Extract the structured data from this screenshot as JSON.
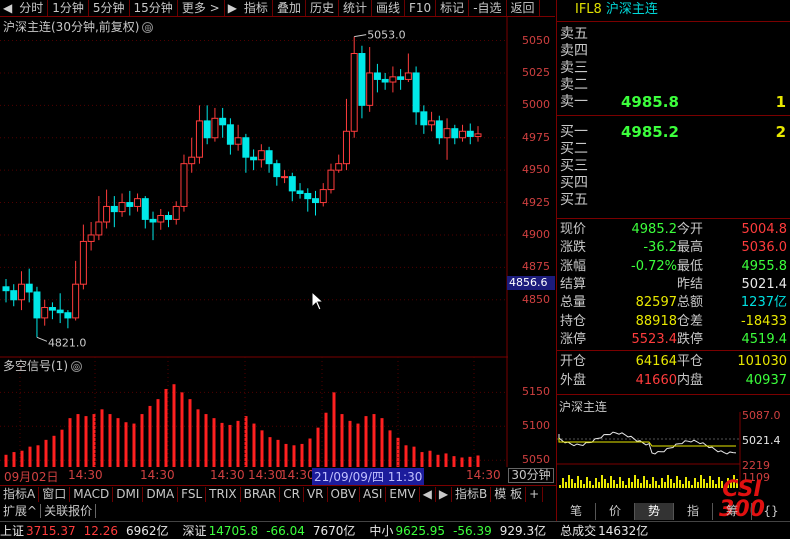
{
  "toolbar": {
    "items": [
      "分时",
      "1分钟",
      "5分钟",
      "15分钟",
      "更多 >",
      "指标",
      "叠加",
      "历史",
      "统计",
      "画线",
      "F10",
      "标记",
      "-自选",
      "返回"
    ],
    "arrow_left": "◀",
    "arrow_right": "▶"
  },
  "chart": {
    "title": "沪深主连(30分钟,前复权)",
    "title_icon": "◎",
    "price_labels": [
      "5050",
      "5025",
      "5000",
      "4975",
      "4950",
      "4925",
      "4900",
      "4875",
      "4850"
    ],
    "current_price_tag": "4856.6",
    "high_mark": "5053.0",
    "low_mark": "4821.0"
  },
  "chart_data": [
    {
      "type": "candlestick",
      "title": "沪深主连(30分钟,前复权)",
      "ylim": [
        4812,
        5062
      ],
      "candles": [
        [
          4860,
          4857,
          4866,
          4848
        ],
        [
          4857,
          4850,
          4862,
          4845
        ],
        [
          4850,
          4862,
          4872,
          4842
        ],
        [
          4862,
          4856,
          4874,
          4848
        ],
        [
          4856,
          4836,
          4860,
          4821
        ],
        [
          4836,
          4844,
          4850,
          4830
        ],
        [
          4844,
          4842,
          4848,
          4835
        ],
        [
          4842,
          4840,
          4855,
          4832
        ],
        [
          4840,
          4836,
          4842,
          4828
        ],
        [
          4836,
          4862,
          4880,
          4834
        ],
        [
          4862,
          4895,
          4908,
          4858
        ],
        [
          4895,
          4900,
          4910,
          4888
        ],
        [
          4900,
          4910,
          4930,
          4896
        ],
        [
          4910,
          4922,
          4935,
          4905
        ],
        [
          4922,
          4918,
          4930,
          4906
        ],
        [
          4918,
          4925,
          4932,
          4914
        ],
        [
          4925,
          4922,
          4934,
          4915
        ],
        [
          4922,
          4928,
          4932,
          4918
        ],
        [
          4928,
          4912,
          4930,
          4905
        ],
        [
          4912,
          4910,
          4918,
          4896
        ],
        [
          4910,
          4915,
          4920,
          4904
        ],
        [
          4915,
          4912,
          4918,
          4906
        ],
        [
          4912,
          4922,
          4926,
          4908
        ],
        [
          4922,
          4955,
          4962,
          4918
        ],
        [
          4955,
          4960,
          4975,
          4948
        ],
        [
          4960,
          4988,
          5000,
          4955
        ],
        [
          4988,
          4975,
          5000,
          4970
        ],
        [
          4975,
          4990,
          4998,
          4972
        ],
        [
          4990,
          4985,
          4998,
          4975
        ],
        [
          4985,
          4970,
          4990,
          4962
        ],
        [
          4970,
          4975,
          4985,
          4965
        ],
        [
          4975,
          4960,
          4978,
          4948
        ],
        [
          4960,
          4958,
          4966,
          4950
        ],
        [
          4958,
          4965,
          4970,
          4952
        ],
        [
          4965,
          4955,
          4968,
          4948
        ],
        [
          4955,
          4945,
          4958,
          4938
        ],
        [
          4945,
          4945,
          4950,
          4940
        ],
        [
          4945,
          4934,
          4948,
          4926
        ],
        [
          4934,
          4932,
          4940,
          4928
        ],
        [
          4932,
          4928,
          4936,
          4918
        ],
        [
          4928,
          4925,
          4934,
          4915
        ],
        [
          4925,
          4935,
          4940,
          4922
        ],
        [
          4935,
          4950,
          4955,
          4932
        ],
        [
          4950,
          4955,
          4962,
          4948
        ],
        [
          4955,
          4980,
          5005,
          4950
        ],
        [
          4980,
          5040,
          5053,
          4975
        ],
        [
          5040,
          5000,
          5046,
          4990
        ],
        [
          5000,
          5025,
          5045,
          4995
        ],
        [
          5025,
          5020,
          5032,
          5010
        ],
        [
          5020,
          5018,
          5025,
          5012
        ],
        [
          5018,
          5022,
          5030,
          5010
        ],
        [
          5022,
          5020,
          5028,
          5012
        ],
        [
          5020,
          5025,
          5040,
          5018
        ],
        [
          5025,
          4995,
          5030,
          4985
        ],
        [
          4995,
          4985,
          5000,
          4978
        ],
        [
          4985,
          4988,
          4995,
          4980
        ],
        [
          4988,
          4975,
          4992,
          4970
        ],
        [
          4975,
          4982,
          4990,
          4958
        ],
        [
          4982,
          4975,
          4985,
          4970
        ],
        [
          4975,
          4980,
          4985,
          4972
        ],
        [
          4980,
          4976,
          4986,
          4970
        ],
        [
          4976,
          4978,
          4984,
          4972
        ]
      ]
    },
    {
      "type": "bar",
      "title": "多空信号(1)",
      "ylim": [
        5040,
        5180
      ],
      "values": [
        5058,
        5062,
        5064,
        5070,
        5072,
        5080,
        5086,
        5095,
        5112,
        5118,
        5115,
        5118,
        5125,
        5118,
        5112,
        5106,
        5104,
        5118,
        5130,
        5140,
        5155,
        5162,
        5150,
        5140,
        5125,
        5118,
        5112,
        5105,
        5102,
        5108,
        5115,
        5104,
        5094,
        5084,
        5080,
        5074,
        5072,
        5074,
        5082,
        5098,
        5120,
        5150,
        5118,
        5108,
        5104,
        5115,
        5118,
        5112,
        5094,
        5083,
        5072,
        5070,
        5062,
        5064,
        5058,
        5060,
        5056,
        5054,
        5055,
        5057
      ]
    }
  ],
  "x_axis": {
    "labels": [
      "09月02日",
      "14:30",
      "14:30",
      "14:30",
      "14:30",
      "14:30",
      "21/09/09/四 11:30",
      "14:30"
    ],
    "period_button": "30分钟"
  },
  "osc": {
    "title": "多空信号(1)",
    "labels": [
      "5150",
      "5100",
      "5050"
    ]
  },
  "indicator_tabs": [
    "指标A",
    "窗口",
    "MACD",
    "DMI",
    "DMA",
    "FSL",
    "TRIX",
    "BRAR",
    "CR",
    "VR",
    "OBV",
    "ASI",
    "EMV",
    "◀",
    "▶",
    "指标B",
    "模 板",
    "+"
  ],
  "ext_tabs": [
    "扩展^",
    "关联报价"
  ],
  "status_bar": {
    "items": [
      {
        "label": "上证",
        "value": "3715.37",
        "change": "12.26",
        "amount": "6962亿"
      },
      {
        "label": "深证",
        "value": "14705.8",
        "change": "-66.04",
        "amount": "7670亿"
      },
      {
        "label": "中小",
        "value": "9625.95",
        "change": "-56.39",
        "amount": "929.3亿"
      }
    ],
    "total_label": "总成交",
    "total_value": "14632亿"
  },
  "panel": {
    "code": "IFL8",
    "name": "沪深主连",
    "asks": [
      {
        "label": "卖五",
        "price": "",
        "vol": ""
      },
      {
        "label": "卖四",
        "price": "",
        "vol": ""
      },
      {
        "label": "卖三",
        "price": "",
        "vol": ""
      },
      {
        "label": "卖二",
        "price": "",
        "vol": ""
      },
      {
        "label": "卖一",
        "price": "4985.8",
        "vol": "1"
      }
    ],
    "bids": [
      {
        "label": "买一",
        "price": "4985.2",
        "vol": "2"
      },
      {
        "label": "买二",
        "price": "",
        "vol": ""
      },
      {
        "label": "买三",
        "price": "",
        "vol": ""
      },
      {
        "label": "买四",
        "price": "",
        "vol": ""
      },
      {
        "label": "买五",
        "price": "",
        "vol": ""
      }
    ],
    "quotes": [
      {
        "l1": "现价",
        "v1": "4985.2",
        "c1": "green",
        "l2": "今开",
        "v2": "5004.8",
        "c2": "red"
      },
      {
        "l1": "涨跌",
        "v1": "-36.2",
        "c1": "green",
        "l2": "最高",
        "v2": "5036.0",
        "c2": "red"
      },
      {
        "l1": "涨幅",
        "v1": "-0.72%",
        "c1": "green",
        "l2": "最低",
        "v2": "4955.8",
        "c2": "green"
      },
      {
        "l1": "结算",
        "v1": "",
        "c1": "white",
        "l2": "昨结",
        "v2": "5021.4",
        "c2": "white"
      },
      {
        "l1": "总量",
        "v1": "82597",
        "c1": "yellow",
        "l2": "总额",
        "v2": "1237亿",
        "c2": "cyan"
      },
      {
        "l1": "持仓",
        "v1": "88918",
        "c1": "yellow",
        "l2": "仓差",
        "v2": "-18433",
        "c2": "yellow"
      },
      {
        "l1": "涨停",
        "v1": "5523.4",
        "c1": "red",
        "l2": "跌停",
        "v2": "4519.4",
        "c2": "green"
      }
    ],
    "trade": [
      {
        "l1": "开仓",
        "v1": "64164",
        "c1": "yellow",
        "l2": "平仓",
        "v2": "101030",
        "c2": "yellow"
      },
      {
        "l1": "外盘",
        "v1": "41660",
        "c1": "red",
        "l2": "内盘",
        "v2": "40937",
        "c2": "green"
      }
    ],
    "mini_title": "沪深主连",
    "mini_labels": [
      "5087.0",
      "5021.4",
      "2219",
      "1109"
    ],
    "tabs": [
      "笔",
      "价",
      "势",
      "指",
      "筹",
      "{}"
    ],
    "logo_text": "CSI 300"
  },
  "colors": {
    "up": "#ff3c3c",
    "down": "#00e8e8",
    "bg": "#000000",
    "grid": "#7a0000"
  }
}
